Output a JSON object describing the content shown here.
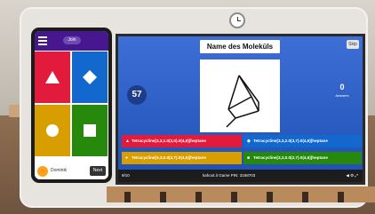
{
  "colors": {
    "red": "#e21b3c",
    "blue": "#1368ce",
    "yellow": "#d89e00",
    "green": "#26890c",
    "purple": "#46178f"
  },
  "phone": {
    "top_pill": "Join",
    "player_name": "Dominik",
    "score": "Next",
    "pads": [
      {
        "color": "red",
        "icon": "triangle-icon"
      },
      {
        "color": "blue",
        "icon": "diamond-icon"
      },
      {
        "color": "yellow",
        "icon": "circle-icon"
      },
      {
        "color": "green",
        "icon": "square-icon"
      }
    ]
  },
  "board": {
    "question": "Name des Moleküls",
    "skip_label": "Skip",
    "timer": "57",
    "answers_count": "0",
    "answers_label": "Answers",
    "answers": [
      {
        "color": "red",
        "icon": "triangle-icon",
        "text": "Tetracycline[3,3,1.0(2,0).0(4,6)]heptane"
      },
      {
        "color": "blue",
        "icon": "diamond-icon",
        "text": "Tetracycline[3,3,2.0(3,7).0(4,6)]heptane"
      },
      {
        "color": "yellow",
        "icon": "circle-icon",
        "text": "Tetracycline[3,3,0.0(2,7).0(4,5)]heptane"
      },
      {
        "color": "green",
        "icon": "square-icon",
        "text": "Tetracycline[3,2,0.0(2,7).0(4,6)]heptane"
      }
    ],
    "status": {
      "count": "9/10",
      "pin": "kahoot.it  Game PIN: 3168703"
    }
  }
}
